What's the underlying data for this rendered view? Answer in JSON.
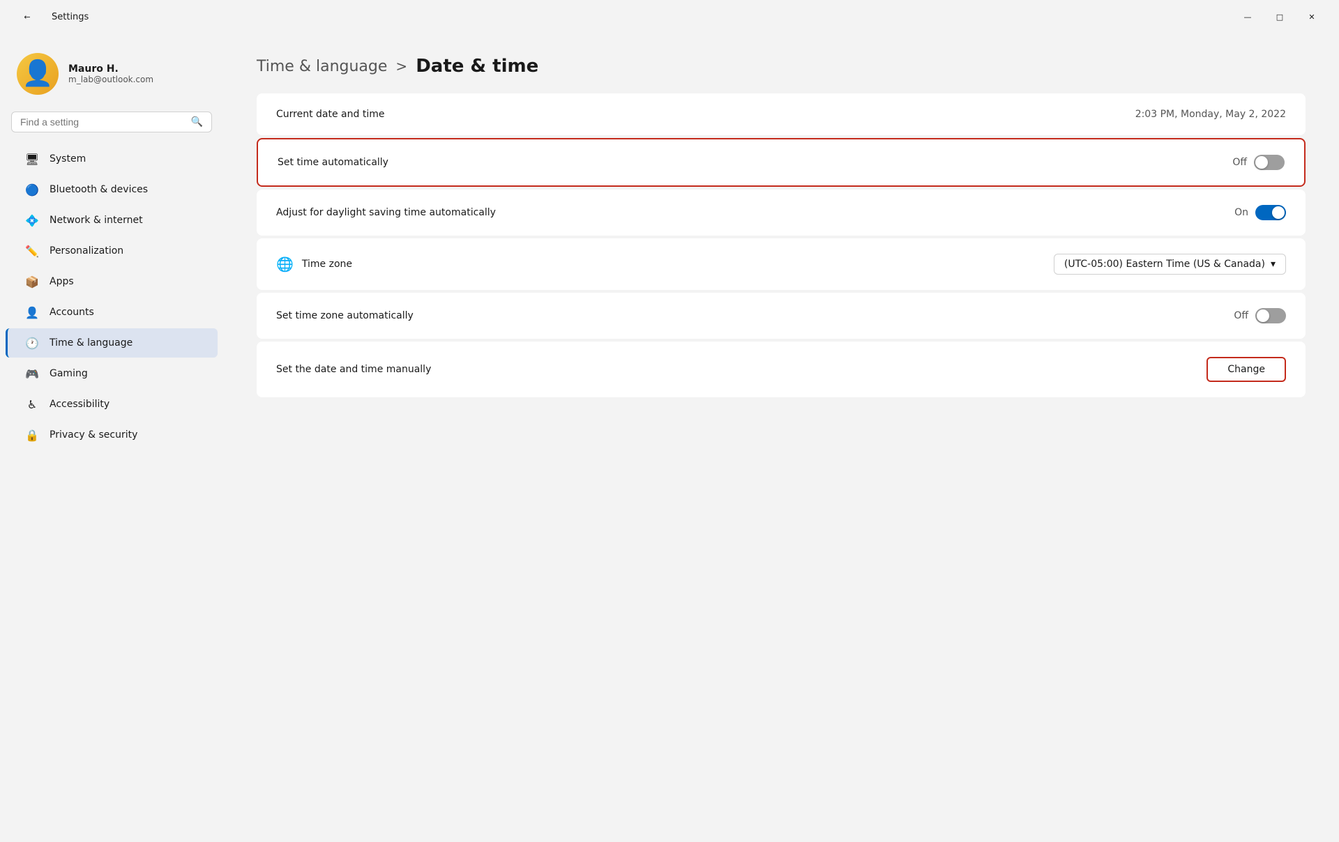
{
  "titlebar": {
    "title": "Settings",
    "back_icon": "←",
    "minimize_icon": "—",
    "maximize_icon": "□",
    "close_icon": "✕"
  },
  "sidebar": {
    "user": {
      "name": "Mauro H.",
      "email": "m_lab@outlook.com"
    },
    "search": {
      "placeholder": "Find a setting"
    },
    "nav_items": [
      {
        "id": "system",
        "label": "System",
        "icon": "🖥",
        "active": false
      },
      {
        "id": "bluetooth",
        "label": "Bluetooth & devices",
        "icon": "🔵",
        "active": false
      },
      {
        "id": "network",
        "label": "Network & internet",
        "icon": "💠",
        "active": false
      },
      {
        "id": "personalization",
        "label": "Personalization",
        "icon": "✏️",
        "active": false
      },
      {
        "id": "apps",
        "label": "Apps",
        "icon": "📦",
        "active": false
      },
      {
        "id": "accounts",
        "label": "Accounts",
        "icon": "👤",
        "active": false
      },
      {
        "id": "time-language",
        "label": "Time & language",
        "icon": "🕐",
        "active": true
      },
      {
        "id": "gaming",
        "label": "Gaming",
        "icon": "🎮",
        "active": false
      },
      {
        "id": "accessibility",
        "label": "Accessibility",
        "icon": "♿",
        "active": false
      },
      {
        "id": "privacy",
        "label": "Privacy & security",
        "icon": "🔒",
        "active": false
      }
    ]
  },
  "content": {
    "breadcrumb_parent": "Time & language",
    "breadcrumb_sep": ">",
    "breadcrumb_current": "Date & time",
    "current_date_time_label": "Current date and time",
    "current_date_time_value": "2:03 PM, Monday, May 2, 2022",
    "set_time_auto_label": "Set time automatically",
    "set_time_auto_state": "Off",
    "set_time_auto_toggle": "off",
    "daylight_label": "Adjust for daylight saving time automatically",
    "daylight_state": "On",
    "daylight_toggle": "on",
    "timezone_label": "Time zone",
    "timezone_icon": "🌐",
    "timezone_value": "(UTC-05:00) Eastern Time (US & Canada)",
    "set_tz_auto_label": "Set time zone automatically",
    "set_tz_auto_state": "Off",
    "set_tz_auto_toggle": "off",
    "manual_date_label": "Set the date and time manually",
    "change_btn_label": "Change"
  }
}
